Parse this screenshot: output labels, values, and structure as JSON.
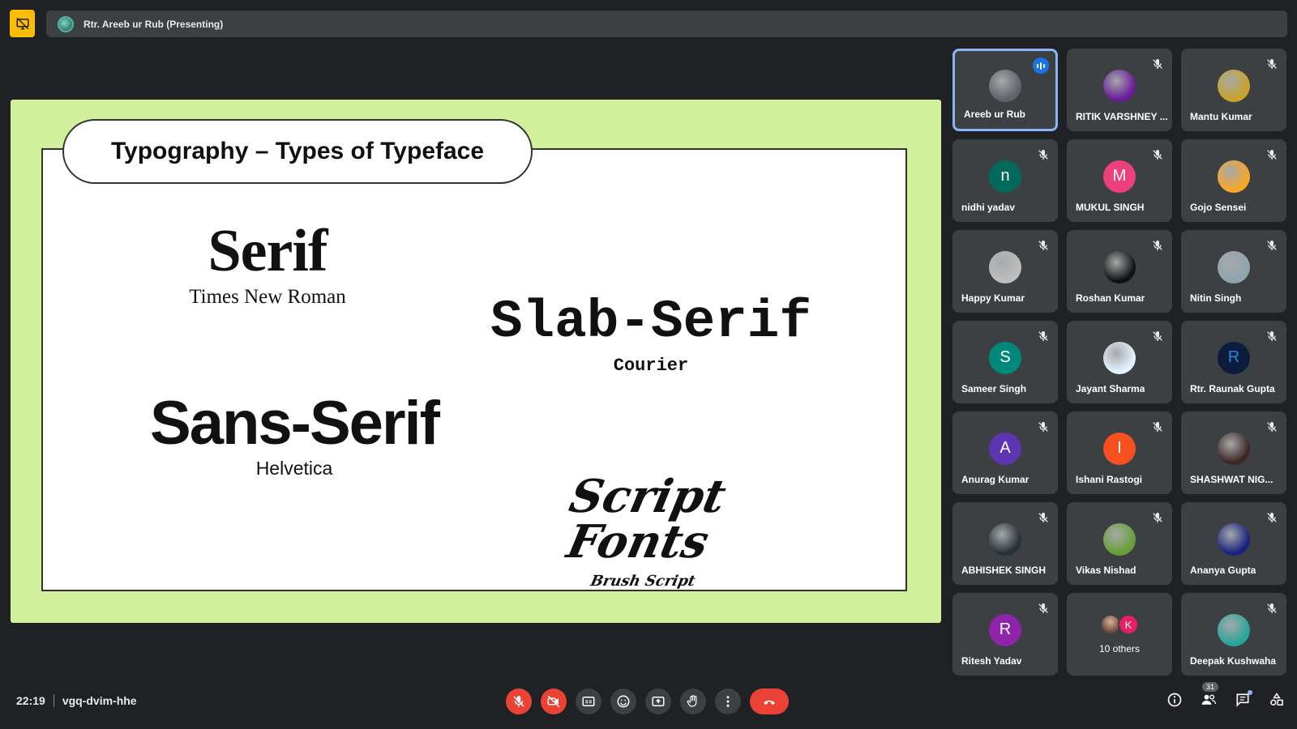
{
  "presenter_bar": {
    "name": "Rtr. Areeb ur Rub (Presenting)"
  },
  "slide": {
    "title": "Typography – Types of Typeface",
    "serif": {
      "name": "Serif",
      "example": "Times New Roman"
    },
    "slab_serif": {
      "name": "Slab-Serif",
      "example": "Courier"
    },
    "sans_serif": {
      "name": "Sans-Serif",
      "example": "Helvetica"
    },
    "script": {
      "name": "Script Fonts",
      "example": "Brush Script"
    }
  },
  "participants": [
    {
      "name": "Areeb ur Rub",
      "avatar_type": "image",
      "color": "#5f6368",
      "speaking": true
    },
    {
      "name": "RITIK VARSHNEY ...",
      "avatar_type": "image",
      "color": "#6a1b9a"
    },
    {
      "name": "Mantu Kumar",
      "avatar_type": "image",
      "color": "#c9a227"
    },
    {
      "name": "nidhi yadav",
      "initial": "n",
      "color": "#00695c"
    },
    {
      "name": "MUKUL SINGH",
      "initial": "M",
      "color": "#ec407a"
    },
    {
      "name": "Gojo Sensei",
      "avatar_type": "image",
      "color": "#f9a825"
    },
    {
      "name": "Happy Kumar",
      "avatar_type": "image",
      "color": "#bdbdbd"
    },
    {
      "name": "Roshan Kumar",
      "avatar_type": "image",
      "color": "#111111"
    },
    {
      "name": "Nitin Singh",
      "avatar_type": "image",
      "color": "#90a4ae"
    },
    {
      "name": "Sameer Singh",
      "initial": "S",
      "color": "#00897b"
    },
    {
      "name": "Jayant Sharma",
      "avatar_type": "image",
      "color": "#e3f2fd"
    },
    {
      "name": "Rtr. Raunak Gupta",
      "avatar_type": "image",
      "color": "#0d1b3d",
      "initial": "R"
    },
    {
      "name": "Anurag Kumar",
      "initial": "A",
      "color": "#5e35b1"
    },
    {
      "name": "Ishani Rastogi",
      "initial": "I",
      "color": "#f4511e"
    },
    {
      "name": "SHASHWAT NIG...",
      "avatar_type": "image",
      "color": "#3e2723"
    },
    {
      "name": "ABHISHEK SINGH",
      "avatar_type": "image",
      "color": "#263238"
    },
    {
      "name": "Vikas Nishad",
      "avatar_type": "image",
      "color": "#689f38"
    },
    {
      "name": "Ananya Gupta",
      "avatar_type": "image",
      "color": "#1a237e"
    },
    {
      "name": "Ritesh Yadav",
      "initial": "R",
      "color": "#8e24aa"
    },
    {
      "others": true,
      "label": "10 others",
      "initial": "K"
    },
    {
      "name": "Deepak Kushwaha",
      "avatar_type": "image",
      "color": "#26a69a"
    }
  ],
  "bottom": {
    "time": "22:19",
    "meeting_code": "vgq-dvim-hhe",
    "people_count": "31"
  },
  "icons": {
    "mic": "mic-off-icon",
    "camera": "camera-off-icon",
    "captions": "captions-icon",
    "emoji": "emoji-icon",
    "present": "present-screen-icon",
    "hand": "raise-hand-icon",
    "more": "more-options-icon",
    "end": "end-call-icon"
  }
}
